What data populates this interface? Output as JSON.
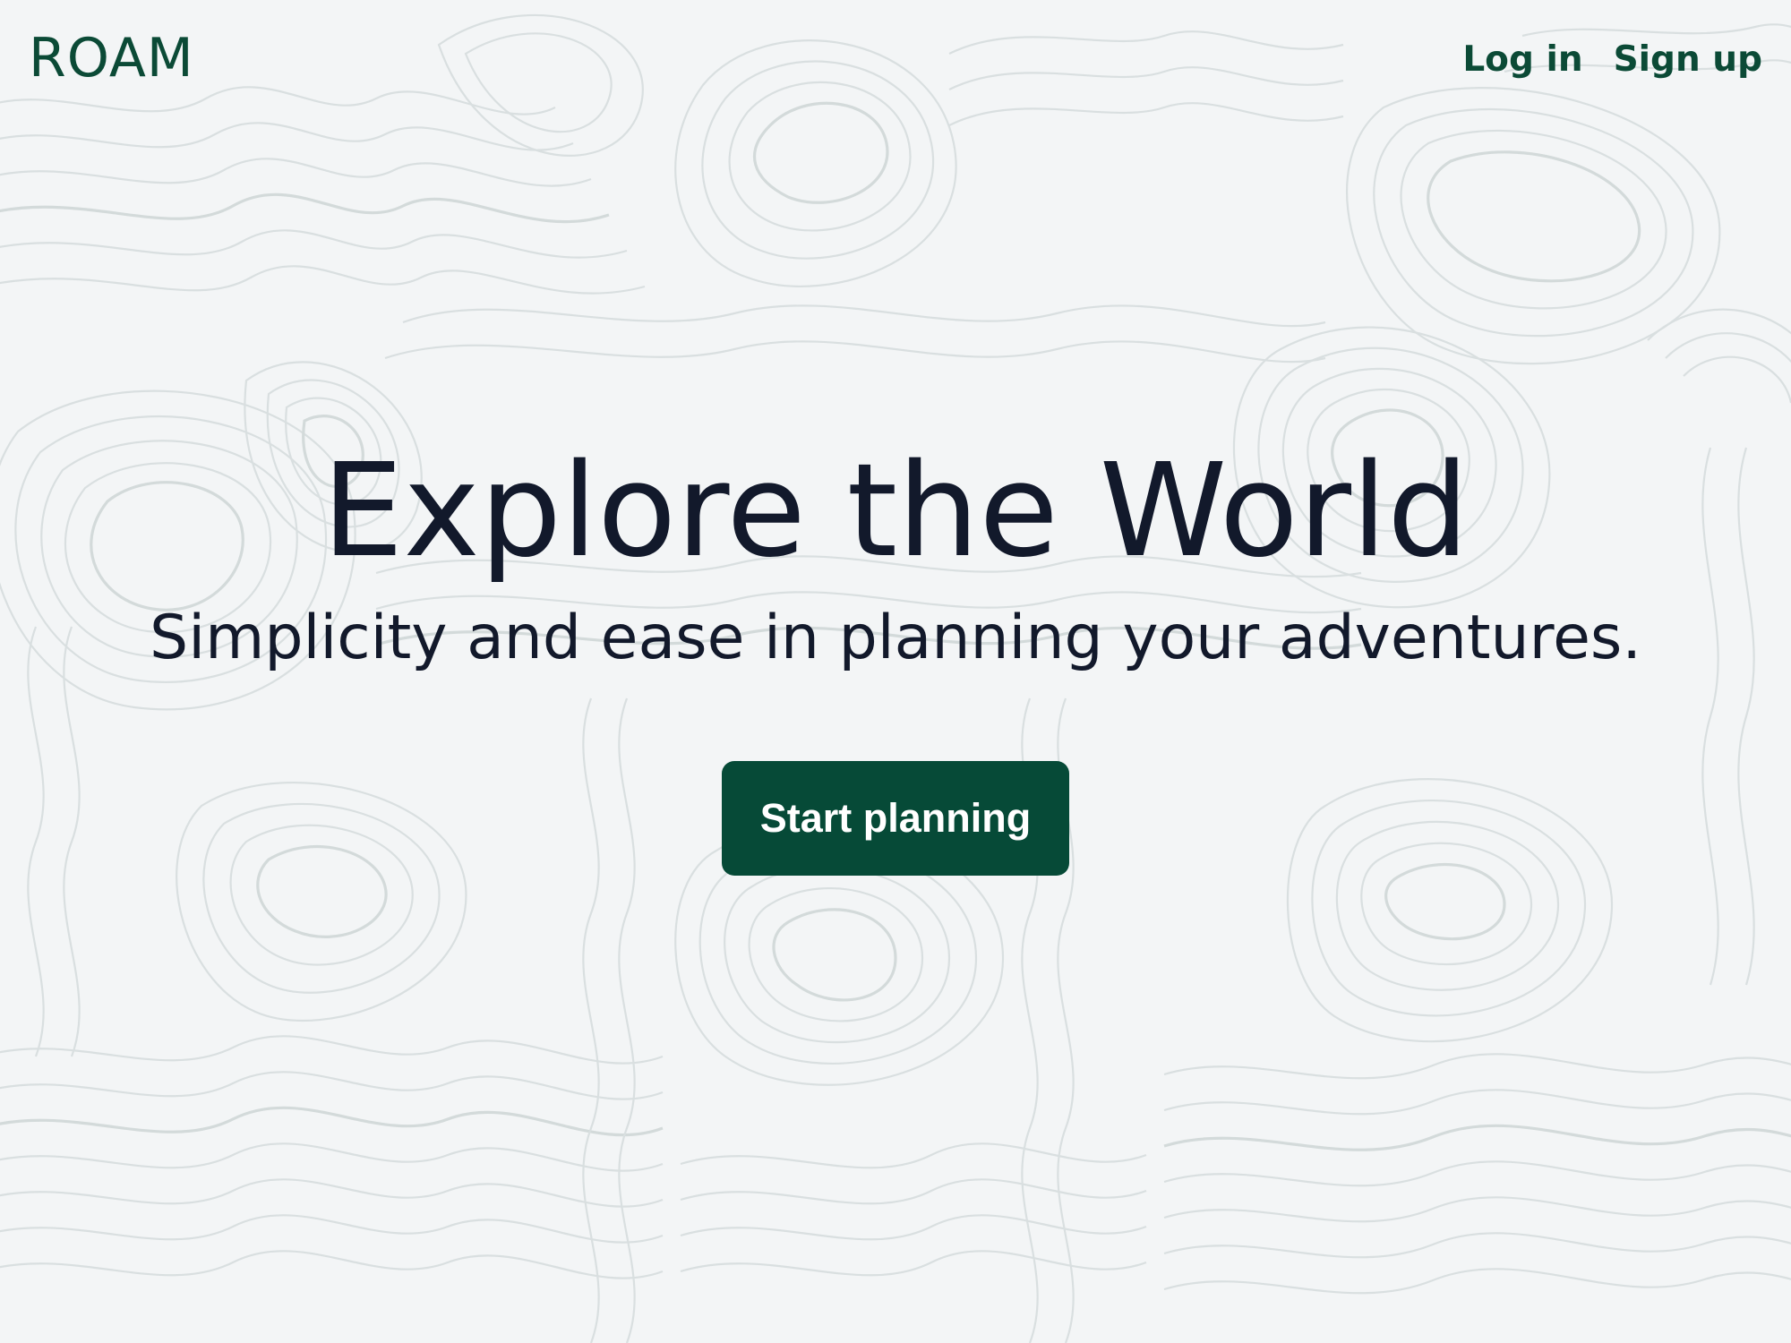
{
  "brand": {
    "name": "ROAM"
  },
  "nav": {
    "login_label": "Log in",
    "signup_label": "Sign up"
  },
  "hero": {
    "title": "Explore the World",
    "subtitle": "Simplicity and ease in planning your adventures.",
    "cta_label": "Start planning"
  },
  "colors": {
    "brand_green": "#064a37",
    "text_dark": "#12192b",
    "background": "#f3f5f6",
    "contour_line": "#d9dfe0"
  }
}
